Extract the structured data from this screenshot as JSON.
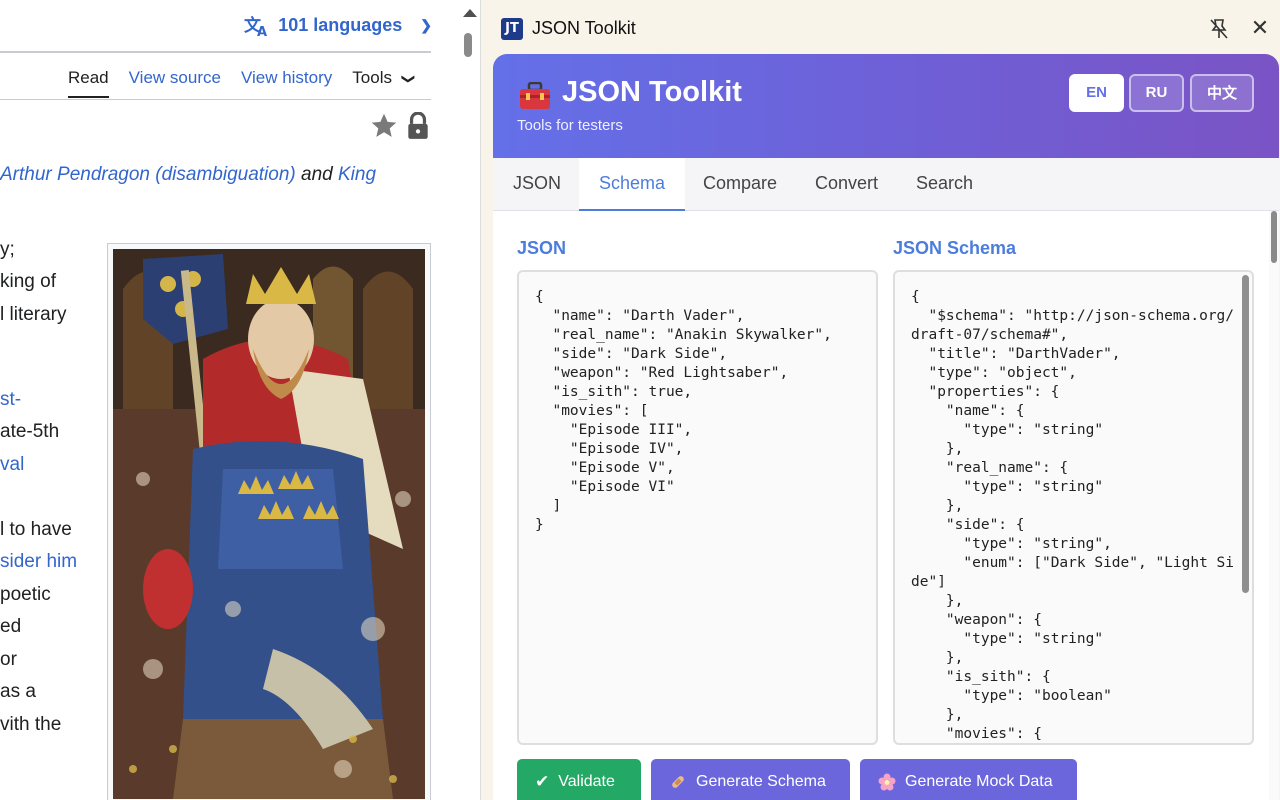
{
  "wiki": {
    "languages_label": "101 languages",
    "tabs": [
      "Read",
      "View source",
      "View history",
      "Tools"
    ],
    "hatnote": {
      "link1": "Arthur Pendragon (disambiguation)",
      "and": "and",
      "link2": "King"
    },
    "body_fragments": [
      {
        "text": "y;",
        "link": false
      },
      {
        "text": "king of",
        "link": false
      },
      {
        "text": "l literary",
        "link": false
      },
      {
        "text": "st-",
        "link": true
      },
      {
        "text": "ate-5th",
        "link": false
      },
      {
        "text": "val",
        "link": true
      },
      {
        "text": "l to have",
        "link": false
      },
      {
        "text": "sider him",
        "link": true
      },
      {
        "text": "poetic",
        "link": false
      },
      {
        "text": "ed",
        "link": false
      },
      {
        "text": "or",
        "link": false
      },
      {
        "text": "as a",
        "link": false
      },
      {
        "text": "vith the",
        "link": false
      }
    ]
  },
  "panel": {
    "window_title": "JSON Toolkit",
    "logo_text": "JT",
    "app_title": "JSON Toolkit",
    "subtitle": "Tools for testers",
    "languages": [
      "EN",
      "RU",
      "中文"
    ],
    "active_language": "EN",
    "tabs": [
      "JSON",
      "Schema",
      "Compare",
      "Convert",
      "Search"
    ],
    "active_tab": "Schema",
    "json_label": "JSON",
    "schema_label": "JSON Schema",
    "json_text": "{\n  \"name\": \"Darth Vader\",\n  \"real_name\": \"Anakin Skywalker\",\n  \"side\": \"Dark Side\",\n  \"weapon\": \"Red Lightsaber\",\n  \"is_sith\": true,\n  \"movies\": [\n    \"Episode III\",\n    \"Episode IV\",\n    \"Episode V\",\n    \"Episode VI\"\n  ]\n}",
    "schema_text": "{\n  \"$schema\": \"http://json-schema.org/draft-07/schema#\",\n  \"title\": \"DarthVader\",\n  \"type\": \"object\",\n  \"properties\": {\n    \"name\": {\n      \"type\": \"string\"\n    },\n    \"real_name\": {\n      \"type\": \"string\"\n    },\n    \"side\": {\n      \"type\": \"string\",\n      \"enum\": [\"Dark Side\", \"Light Side\"]\n    },\n    \"weapon\": {\n      \"type\": \"string\"\n    },\n    \"is_sith\": {\n      \"type\": \"boolean\"\n    },\n    \"movies\": {",
    "buttons": {
      "validate": "Validate",
      "generate_schema": "Generate Schema",
      "generate_mock": "Generate Mock Data"
    },
    "colors": {
      "accent": "#4c7ddc",
      "validate": "#24a866",
      "action": "#6b66dc"
    }
  }
}
